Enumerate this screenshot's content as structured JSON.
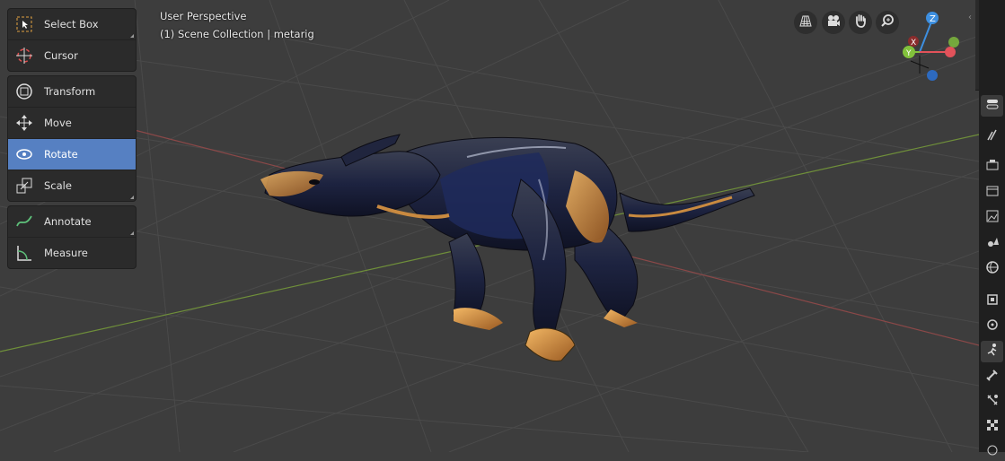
{
  "viewport": {
    "perspective_label": "User Perspective",
    "collection_label": "(1) Scene Collection | metarig"
  },
  "toolbar": {
    "groups": [
      [
        {
          "label": "Select Box",
          "icon": "select-box-icon",
          "active": false
        },
        {
          "label": "Cursor",
          "icon": "cursor-icon",
          "active": false
        }
      ],
      [
        {
          "label": "Transform",
          "icon": "transform-icon",
          "active": false
        },
        {
          "label": "Move",
          "icon": "move-icon",
          "active": false
        },
        {
          "label": "Rotate",
          "icon": "rotate-icon",
          "active": true
        },
        {
          "label": "Scale",
          "icon": "scale-icon",
          "active": false
        }
      ],
      [
        {
          "label": "Annotate",
          "icon": "annotate-icon",
          "active": false
        },
        {
          "label": "Measure",
          "icon": "measure-icon",
          "active": false
        }
      ]
    ]
  },
  "nav_buttons": [
    "grid-view-icon",
    "camera-icon",
    "hand-pan-icon",
    "zoom-icon"
  ],
  "gizmo": {
    "z": "Z",
    "y": "Y",
    "x": "X"
  },
  "properties_tabs": [
    "tool-icon",
    "render-icon",
    "output-icon",
    "view-layer-icon",
    "scene-icon",
    "world-icon",
    "object-icon",
    "modifier-icon",
    "particles-icon",
    "physics-icon",
    "constraints-icon",
    "data-icon",
    "texture-icon"
  ],
  "colors": {
    "accent": "#5680c2",
    "axis_x": "#e2525a",
    "axis_y": "#82c23c",
    "axis_z": "#3d8fe0"
  }
}
